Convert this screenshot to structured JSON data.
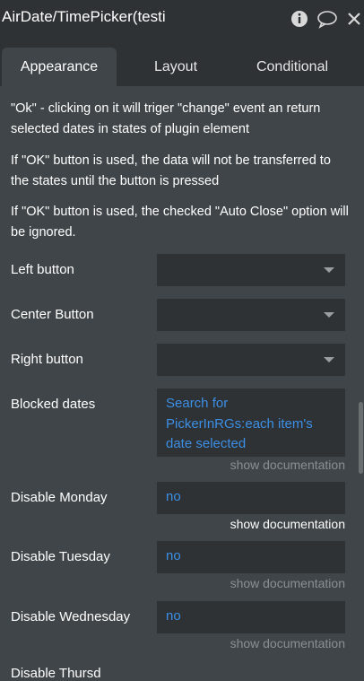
{
  "header": {
    "title": "AirDate/TimePicker(testi",
    "icons": [
      "info-icon",
      "comment-icon",
      "close-icon"
    ]
  },
  "tabs": [
    {
      "label": "Appearance",
      "active": true
    },
    {
      "label": "Layout",
      "active": false
    },
    {
      "label": "Conditional",
      "active": false
    }
  ],
  "notes": [
    "\"Ok\" - clicking on it will triger \"change\" event an return selected dates in states of plugin element",
    "If \"OK\" button is used, the data will not be transferred to the states until the button is pressed",
    "If \"OK\" button is used, the checked \"Auto Close\" option will be ignored."
  ],
  "properties": {
    "left_button": {
      "label": "Left button",
      "value": ""
    },
    "center_button": {
      "label": "Center Button",
      "value": ""
    },
    "right_button": {
      "label": "Right button",
      "value": ""
    },
    "blocked_dates": {
      "label": "Blocked dates",
      "value": "Search for PickerInRGs:each item's date selected"
    },
    "disable_monday": {
      "label": "Disable Monday",
      "value": "no"
    },
    "disable_tuesday": {
      "label": "Disable Tuesday",
      "value": "no"
    },
    "disable_wednesday": {
      "label": "Disable Wednesday",
      "value": "no"
    },
    "disable_thursday": {
      "label": "Disable Thursd"
    }
  },
  "docs_label": "show documentation",
  "colors": {
    "panel": "#3f4549",
    "header": "#2e3234",
    "input": "#2e3234",
    "dynamic_value": "#3c8fe6",
    "muted": "#8a8f92"
  }
}
